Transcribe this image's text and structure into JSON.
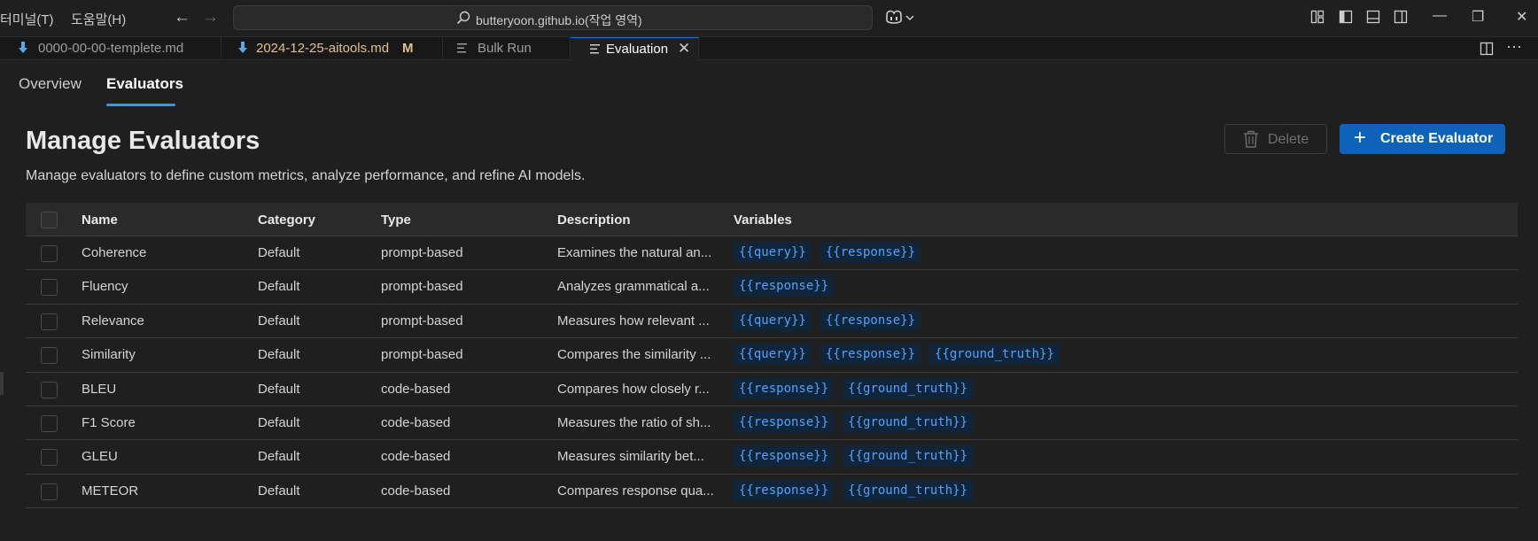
{
  "menu": {
    "terminal": "터미널(T)",
    "help": "도움말(H)"
  },
  "search": {
    "text": "butteryoon.github.io(작업 영역)"
  },
  "icons": {
    "back": "arrow-left-icon",
    "forward": "arrow-right-icon",
    "search": "search-icon",
    "copilot": "copilot-icon",
    "trash": "trash-icon",
    "plus": "plus-icon"
  },
  "tabs": [
    {
      "label": "0000-00-00-templete.md",
      "modified": ""
    },
    {
      "label": "2024-12-25-aitools.md",
      "modified": "M"
    },
    {
      "label": "Bulk Run",
      "modified": ""
    },
    {
      "label": "Evaluation",
      "modified": ""
    }
  ],
  "subtabs": {
    "overview": "Overview",
    "evaluators": "Evaluators"
  },
  "header": {
    "title": "Manage Evaluators",
    "subtitle": "Manage evaluators to define custom metrics, analyze performance, and refine AI models.",
    "delete_label": "Delete",
    "create_label": "Create Evaluator"
  },
  "table": {
    "columns": {
      "name": "Name",
      "category": "Category",
      "type": "Type",
      "description": "Description",
      "variables": "Variables"
    },
    "rows": [
      {
        "name": "Coherence",
        "category": "Default",
        "type": "prompt-based",
        "description": "Examines the natural an...",
        "variables": [
          "{{query}}",
          "{{response}}"
        ]
      },
      {
        "name": "Fluency",
        "category": "Default",
        "type": "prompt-based",
        "description": "Analyzes grammatical a...",
        "variables": [
          "{{response}}"
        ]
      },
      {
        "name": "Relevance",
        "category": "Default",
        "type": "prompt-based",
        "description": "Measures how relevant ...",
        "variables": [
          "{{query}}",
          "{{response}}"
        ]
      },
      {
        "name": "Similarity",
        "category": "Default",
        "type": "prompt-based",
        "description": "Compares the similarity ...",
        "variables": [
          "{{query}}",
          "{{response}}",
          "{{ground_truth}}"
        ]
      },
      {
        "name": "BLEU",
        "category": "Default",
        "type": "code-based",
        "description": "Compares how closely r...",
        "variables": [
          "{{response}}",
          "{{ground_truth}}"
        ]
      },
      {
        "name": "F1 Score",
        "category": "Default",
        "type": "code-based",
        "description": "Measures the ratio of sh...",
        "variables": [
          "{{response}}",
          "{{ground_truth}}"
        ]
      },
      {
        "name": "GLEU",
        "category": "Default",
        "type": "code-based",
        "description": "Measures similarity bet...",
        "variables": [
          "{{response}}",
          "{{ground_truth}}"
        ]
      },
      {
        "name": "METEOR",
        "category": "Default",
        "type": "code-based",
        "description": "Compares response qua...",
        "variables": [
          "{{response}}",
          "{{ground_truth}}"
        ]
      }
    ]
  },
  "colors": {
    "accent": "#0e63b8",
    "variable_text": "#4fa3ff",
    "modified": "#e2c08d"
  }
}
